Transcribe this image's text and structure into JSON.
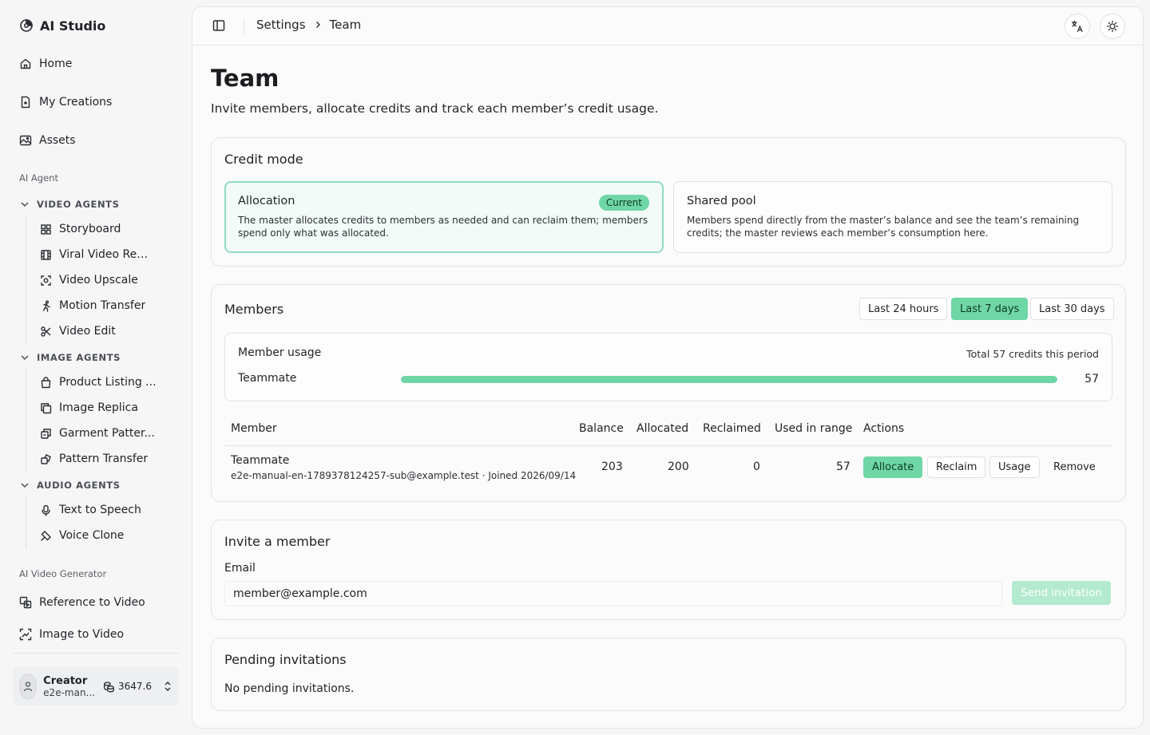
{
  "app": {
    "title": "AI Studio"
  },
  "sidebar": {
    "main_items": [
      {
        "label": "Home",
        "icon": "home-icon"
      },
      {
        "label": "My Creations",
        "icon": "file-icon"
      },
      {
        "label": "Assets",
        "icon": "image-icon"
      }
    ],
    "section_ai_agent": "AI Agent",
    "groups": [
      {
        "label": "VIDEO AGENTS",
        "items": [
          {
            "label": "Storyboard",
            "icon": "grid-icon"
          },
          {
            "label": "Viral Video Rem...",
            "icon": "film-icon"
          },
          {
            "label": "Video Upscale",
            "icon": "scan-icon"
          },
          {
            "label": "Motion Transfer",
            "icon": "running-figure-icon"
          },
          {
            "label": "Video Edit",
            "icon": "scissors-icon"
          }
        ]
      },
      {
        "label": "IMAGE AGENTS",
        "items": [
          {
            "label": "Product Listing ...",
            "icon": "shopping-bag-icon"
          },
          {
            "label": "Image Replica",
            "icon": "copy-icon"
          },
          {
            "label": "Garment Patter...",
            "icon": "layers-icon"
          },
          {
            "label": "Pattern Transfer",
            "icon": "transfer-icon"
          }
        ]
      },
      {
        "label": "AUDIO AGENTS",
        "items": [
          {
            "label": "Text to Speech",
            "icon": "microphone-icon"
          },
          {
            "label": "Voice Clone",
            "icon": "pen-icon"
          }
        ]
      }
    ],
    "section_video_generator": "AI Video Generator",
    "generator_items": [
      {
        "label": "Reference to Video",
        "icon": "reference-icon"
      },
      {
        "label": "Image to Video",
        "icon": "image-video-icon"
      }
    ],
    "user": {
      "name": "Creator",
      "email": "e2e-man...",
      "credits": "3647.6"
    }
  },
  "topbar": {
    "breadcrumb": [
      "Settings",
      "Team"
    ]
  },
  "page": {
    "title": "Team",
    "description": "Invite members, allocate credits and track each member’s credit usage."
  },
  "credit_mode": {
    "title": "Credit mode",
    "options": [
      {
        "name": "Allocation",
        "badge": "Current",
        "description": "The master allocates credits to members as needed and can reclaim them; members spend only what was allocated."
      },
      {
        "name": "Shared pool",
        "description": "Members spend directly from the master’s balance and see the team’s remaining credits; the master reviews each member’s consumption here."
      }
    ]
  },
  "members": {
    "title": "Members",
    "ranges": [
      "Last 24 hours",
      "Last 7 days",
      "Last 30 days"
    ],
    "selected_range": "Last 7 days",
    "usage": {
      "title": "Member usage",
      "total_text": "Total 57 credits this period",
      "rows": [
        {
          "name": "Teammate",
          "value": "57",
          "fraction": 1.0
        }
      ]
    },
    "columns": [
      "Member",
      "Balance",
      "Allocated",
      "Reclaimed",
      "Used in range",
      "Actions"
    ],
    "rows": [
      {
        "name": "Teammate",
        "meta": "e2e-manual-en-1789378124257-sub@example.test · Joined 2026/09/14",
        "balance": "203",
        "allocated": "200",
        "reclaimed": "0",
        "used": "57",
        "actions": [
          "Allocate",
          "Reclaim",
          "Usage",
          "Remove"
        ]
      }
    ]
  },
  "invite": {
    "title": "Invite a member",
    "email_label": "Email",
    "email_value": "member@example.com",
    "send_label": "Send invitation"
  },
  "pending": {
    "title": "Pending invitations",
    "empty_text": "No pending invitations."
  },
  "colors": {
    "accent": "#6fd6a6",
    "accent_disabled": "#b3ead0"
  }
}
